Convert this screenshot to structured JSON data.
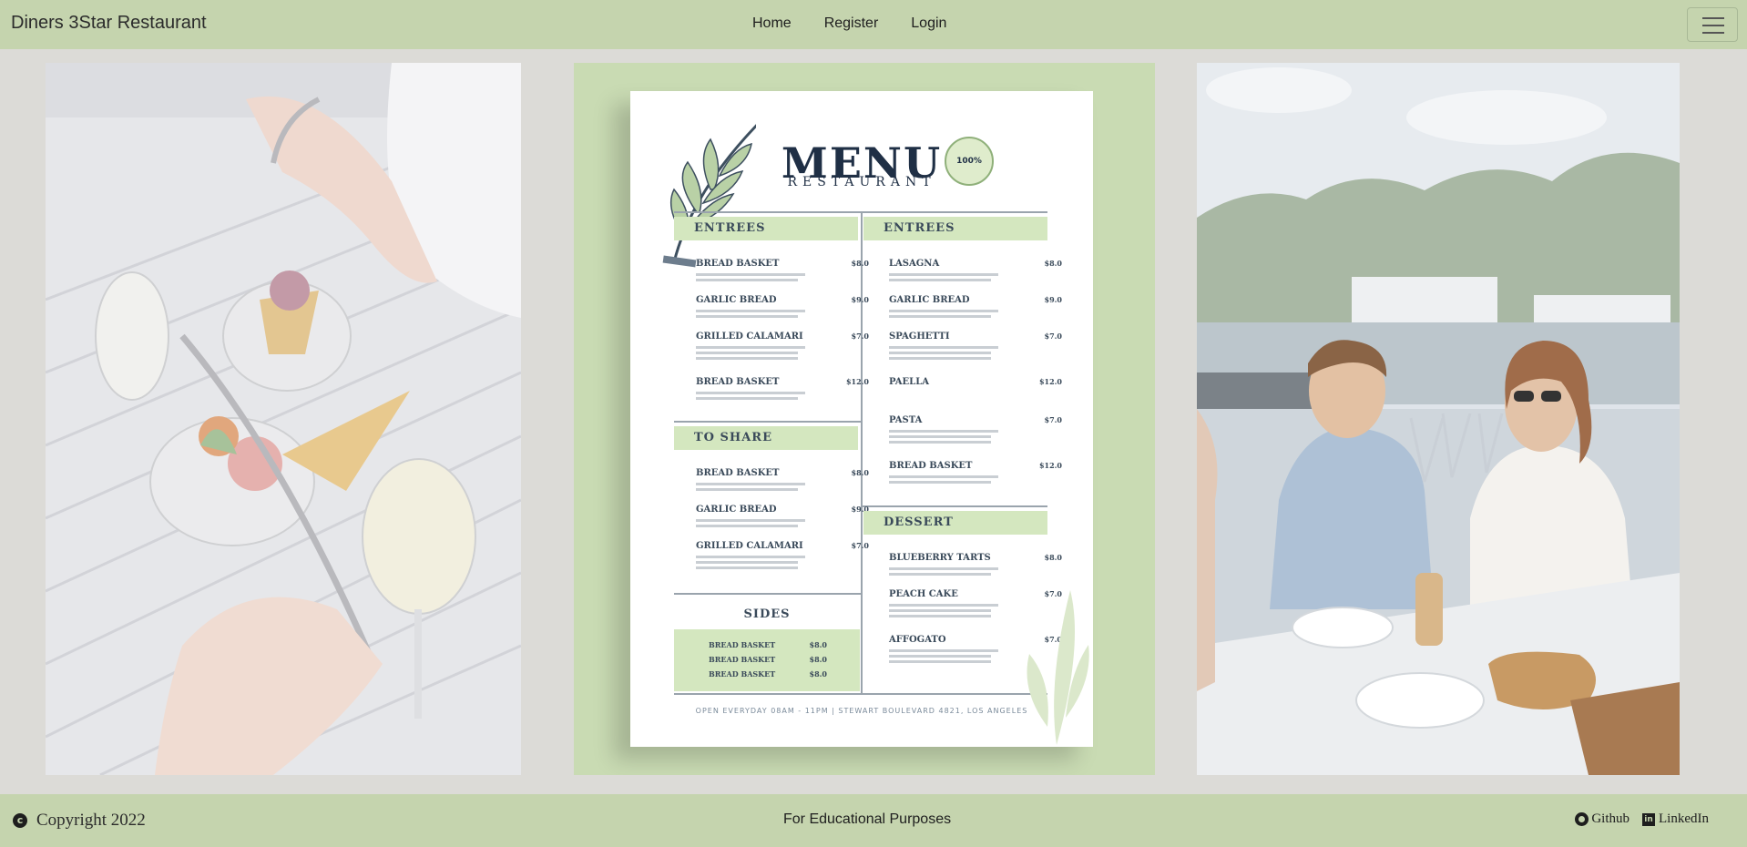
{
  "navbar": {
    "brand": "Diners 3Star Restaurant",
    "links": [
      {
        "label": "Home"
      },
      {
        "label": "Register"
      },
      {
        "label": "Login"
      }
    ],
    "toggler_icon": "hamburger-icon"
  },
  "gallery": {
    "menu": {
      "title": "MENU",
      "subtitle": "RESTAURANT",
      "badge": "100%",
      "left_entrees": {
        "heading": "ENTREES",
        "items": [
          {
            "name": "BREAD BASKET",
            "price": "$8.0"
          },
          {
            "name": "GARLIC BREAD",
            "price": "$9.0"
          },
          {
            "name": "GRILLED CALAMARI",
            "price": "$7.0"
          },
          {
            "name": "BREAD BASKET",
            "price": "$12.0"
          }
        ]
      },
      "to_share": {
        "heading": "TO SHARE",
        "items": [
          {
            "name": "BREAD BASKET",
            "price": "$8.0"
          },
          {
            "name": "GARLIC BREAD",
            "price": "$9.0"
          },
          {
            "name": "GRILLED CALAMARI",
            "price": "$7.0"
          }
        ]
      },
      "sides": {
        "heading": "SIDES",
        "items": [
          {
            "name": "BREAD BASKET",
            "price": "$8.0"
          },
          {
            "name": "BREAD BASKET",
            "price": "$8.0"
          },
          {
            "name": "BREAD BASKET",
            "price": "$8.0"
          }
        ]
      },
      "right_entrees": {
        "heading": "ENTREES",
        "items": [
          {
            "name": "LASAGNA",
            "price": "$8.0"
          },
          {
            "name": "GARLIC BREAD",
            "price": "$9.0"
          },
          {
            "name": "SPAGHETTI",
            "price": "$7.0"
          },
          {
            "name": "PAELLA",
            "price": "$12.0"
          },
          {
            "name": "PASTA",
            "price": "$7.0"
          },
          {
            "name": "BREAD BASKET",
            "price": "$12.0"
          }
        ]
      },
      "dessert": {
        "heading": "DESSERT",
        "items": [
          {
            "name": "BLUEBERRY TARTS",
            "price": "$8.0"
          },
          {
            "name": "PEACH CAKE",
            "price": "$7.0"
          },
          {
            "name": "AFFOGATO",
            "price": "$7.0"
          }
        ]
      },
      "footer": "OPEN EVERYDAY 08AM - 11PM | STEWART BOULEVARD 4821, LOS ANGELES"
    }
  },
  "footer": {
    "copyright": "Copyright 2022",
    "copyright_icon": "copyright-icon",
    "center_text": "For Educational Purposes",
    "github_label": "Github",
    "linkedin_label": "LinkedIn"
  }
}
